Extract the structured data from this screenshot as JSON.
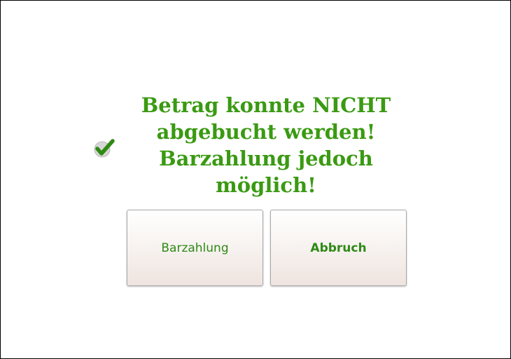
{
  "dialog": {
    "icon": "checkmark-icon",
    "message_lines": [
      "Betrag konnte NICHT",
      "abgebucht werden!",
      "Barzahlung jedoch",
      "möglich!"
    ],
    "text_color": "#3a9a12"
  },
  "buttons": {
    "cash_label": "Barzahlung",
    "abort_label": "Abbruch"
  }
}
